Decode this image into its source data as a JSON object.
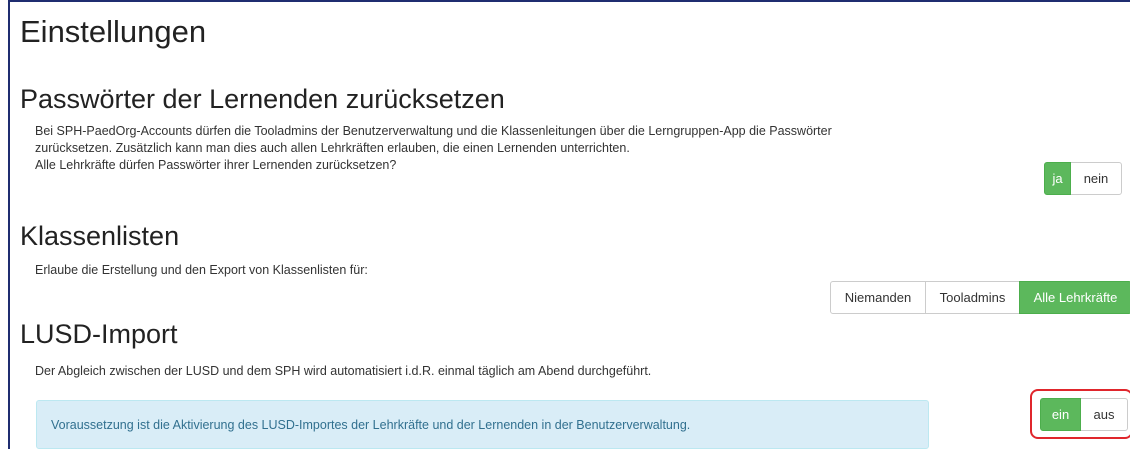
{
  "page": {
    "title": "Einstellungen"
  },
  "password_section": {
    "title": "Passwörter der Lernenden zurücksetzen",
    "line1": "Bei SPH-PaedOrg-Accounts dürfen die Tooladmins der Benutzerverwaltung und die Klassenleitungen über die Lerngruppen-App die Passwörter",
    "line2": "zurücksetzen. Zusätzlich kann man dies auch allen Lehrkräften erlauben, die einen Lernenden unterrichten.",
    "line3": "Alle Lehrkräfte dürfen Passwörter ihrer Lernenden zurücksetzen?",
    "options": [
      {
        "label": "ja",
        "active": true
      },
      {
        "label": "nein",
        "active": false
      }
    ]
  },
  "class_lists_section": {
    "title": "Klassenlisten",
    "description": "Erlaube die Erstellung und den Export von Klassenlisten für:",
    "options": [
      {
        "label": "Niemanden",
        "active": false
      },
      {
        "label": "Tooladmins",
        "active": false
      },
      {
        "label": "Alle Lehrkräfte",
        "active": true
      }
    ]
  },
  "lusd_section": {
    "title": "LUSD-Import",
    "description": "Der Abgleich zwischen der LUSD und dem SPH wird automatisiert i.d.R. einmal täglich am Abend durchgeführt.",
    "info": "Voraussetzung ist die Aktivierung des LUSD-Importes der Lehrkräfte und der Lernenden in der Benutzerverwaltung.",
    "options": [
      {
        "label": "ein",
        "active": true
      },
      {
        "label": "aus",
        "active": false
      }
    ]
  },
  "colors": {
    "active": "#5cb85c",
    "info_bg": "#d9edf7",
    "info_text": "#31708f",
    "highlight": "#e0262c",
    "frame": "#1f2d70"
  }
}
